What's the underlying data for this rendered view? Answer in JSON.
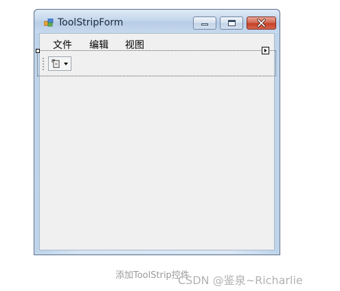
{
  "window": {
    "title": "ToolStripForm",
    "icon": "windows-form-icon"
  },
  "caption_buttons": {
    "minimize_icon": "minimize-icon",
    "maximize_icon": "maximize-icon",
    "close_icon": "close-icon"
  },
  "menubar": {
    "items": [
      {
        "label": "文件"
      },
      {
        "label": "编辑"
      },
      {
        "label": "视图"
      }
    ]
  },
  "toolstrip": {
    "grip_icon": "toolstrip-grip-icon",
    "dropdown_icon": "add-item-icon",
    "smart_tag_icon": "smart-tag-arrow-icon"
  },
  "caption_text": "添加ToolStrip控件",
  "watermark": "CSDN @鉴泉~Richarlie"
}
